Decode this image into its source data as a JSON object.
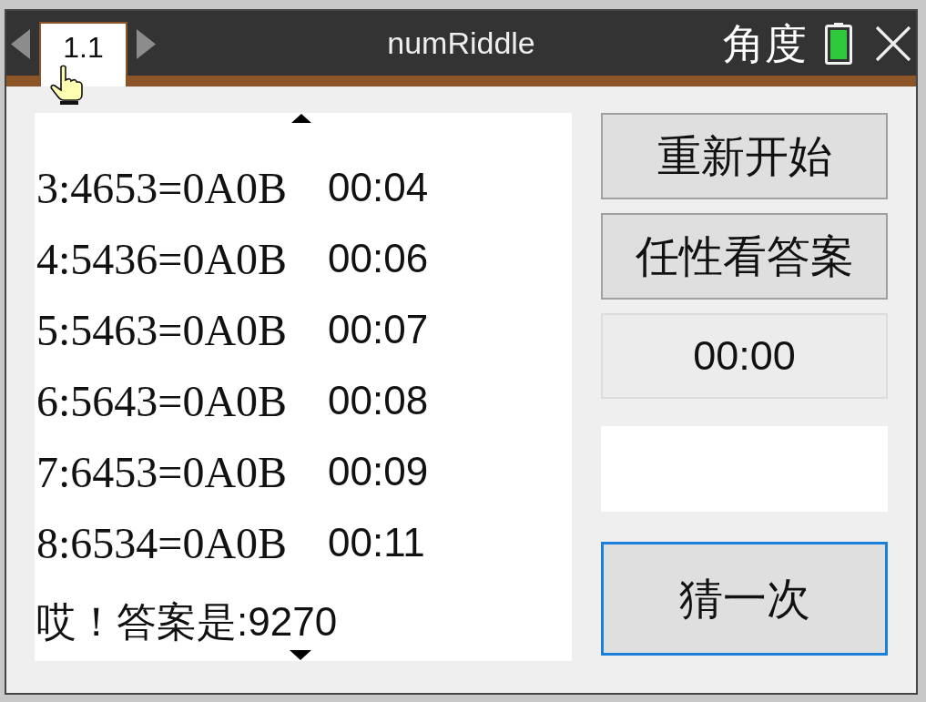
{
  "window": {
    "title": "numRiddle",
    "angle_mode": "角度"
  },
  "tabs": [
    {
      "label": "1.1",
      "selected": true
    }
  ],
  "history": {
    "rows": [
      {
        "guess": "3:4653=0A0B",
        "time": "00:04"
      },
      {
        "guess": "4:5436=0A0B",
        "time": "00:06"
      },
      {
        "guess": "5:5463=0A0B",
        "time": "00:07"
      },
      {
        "guess": "6:5643=0A0B",
        "time": "00:08"
      },
      {
        "guess": "7:6453=0A0B",
        "time": "00:09"
      },
      {
        "guess": "8:6534=0A0B",
        "time": "00:11"
      }
    ],
    "result": "哎！答案是:9270"
  },
  "controls": {
    "buttons": [
      {
        "label": "重新开始",
        "focused": false
      },
      {
        "label": "任性看答案",
        "focused": false
      }
    ],
    "timer": "00:00",
    "guess_button": {
      "label": "猜一次",
      "focused": true
    }
  }
}
